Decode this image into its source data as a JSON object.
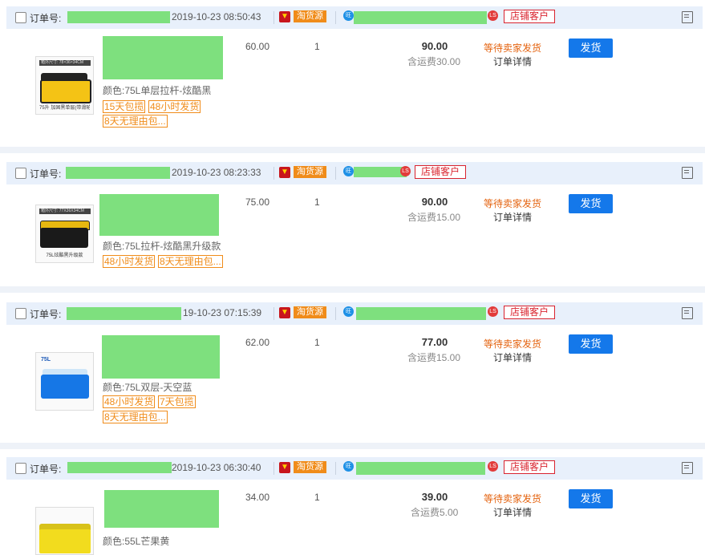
{
  "order_no_label": "订单号:",
  "source_label": "淘货源",
  "customer_label": "店铺客户",
  "ship_button_label": "发货",
  "detail_label": "订单详情",
  "status_label": "等待卖家发货",
  "orders": [
    {
      "time": "2019-10-23 08:50:43",
      "price": "60.00",
      "qty": "1",
      "total": "90.00",
      "shipping": "含运费30.00",
      "attr": "颜色:75L单层拉杆-炫酷黑",
      "tags": [
        "15天包揽",
        "48小时发货",
        "8天无理由包..."
      ],
      "thumb_dim": "箱外尺寸: 78×36×34CM",
      "thumb_caption": "75升 加固黑单层(带滑轮)"
    },
    {
      "time": "2019-10-23 08:23:33",
      "price": "75.00",
      "qty": "1",
      "total": "90.00",
      "shipping": "含运费15.00",
      "attr": "颜色:75L拉杆-炫酷黑升级款",
      "tags": [
        "48小时发货",
        "8天无理由包..."
      ],
      "thumb_dim": "箱外尺寸: 77X36X34CM",
      "thumb_caption": "75L炫酷黑升级款"
    },
    {
      "time": "19-10-23 07:15:39",
      "price": "62.00",
      "qty": "1",
      "total": "77.00",
      "shipping": "含运费15.00",
      "attr": "颜色:75L双层-天空蓝",
      "tags": [
        "48小时发货",
        "7天包揽",
        "8天无理由包..."
      ],
      "thumb_dim": "75L",
      "thumb_caption": ""
    },
    {
      "time": "2019-10-23 06:30:40",
      "price": "34.00",
      "qty": "1",
      "total": "39.00",
      "shipping": "含运费5.00",
      "attr": "颜色:55L芒果黄",
      "tags": [],
      "thumb_dim": "",
      "thumb_caption": ""
    }
  ],
  "colors": {
    "accent_blue": "#1478ea",
    "status_orange": "#e4620e",
    "badge_orange": "#f08c1a",
    "customer_red": "#d9232e",
    "header_bg": "#e8f0fb",
    "mask_green": "#7ee07e"
  },
  "icons": [
    "checkbox",
    "taobao-icon",
    "wangwang-icon",
    "ls-icon",
    "memo-icon"
  ]
}
